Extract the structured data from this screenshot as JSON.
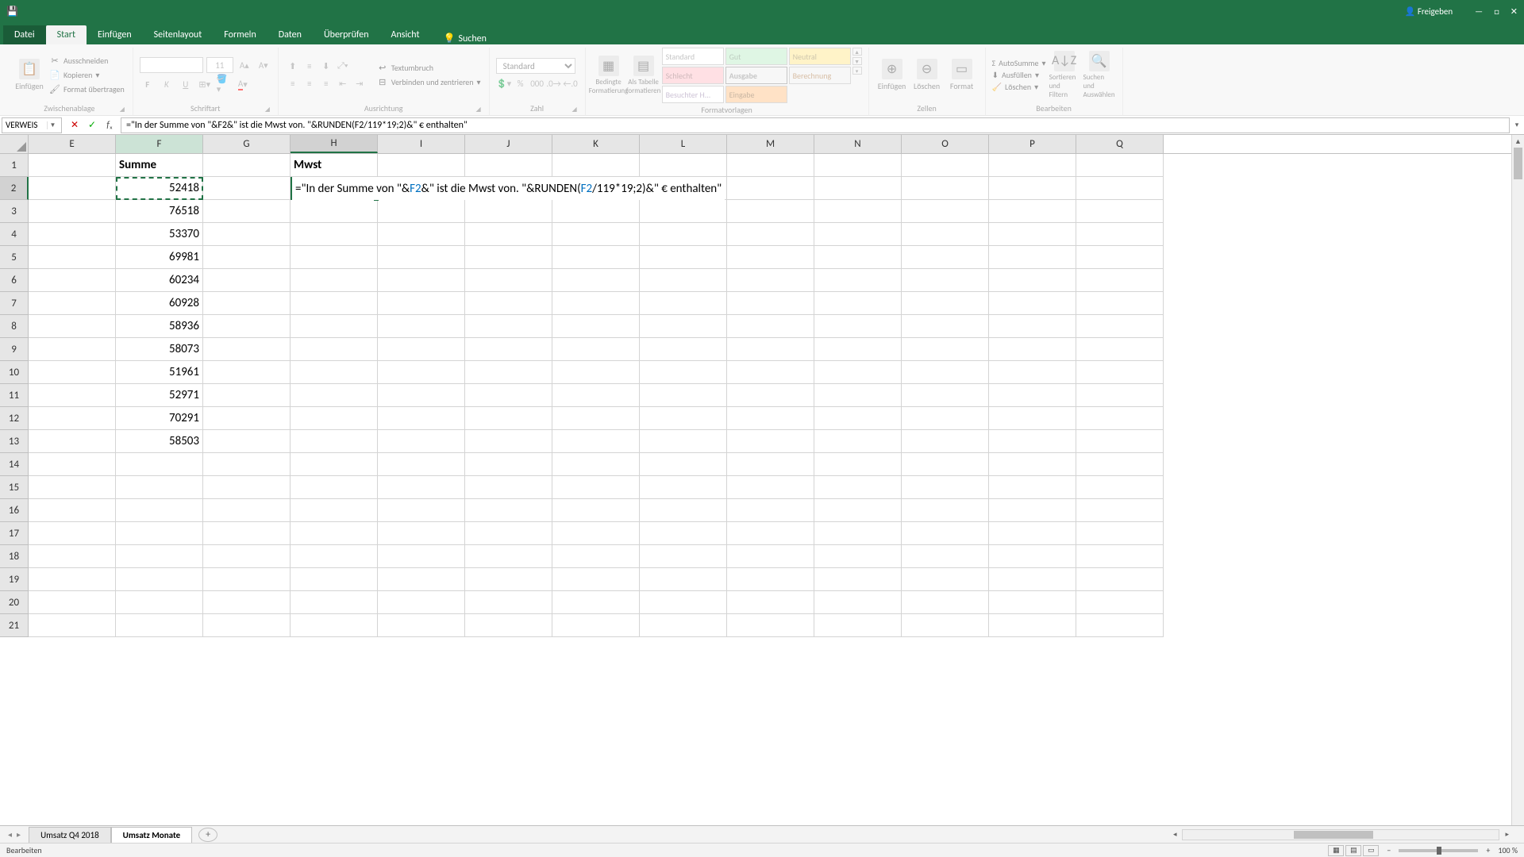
{
  "title_bar": {
    "share": "Freigeben"
  },
  "tabs": {
    "datei": "Datei",
    "start": "Start",
    "einfuegen": "Einfügen",
    "seitenlayout": "Seitenlayout",
    "formeln": "Formeln",
    "daten": "Daten",
    "ueberpruefen": "Überprüfen",
    "ansicht": "Ansicht",
    "tellme": "Suchen"
  },
  "ribbon": {
    "clipboard": {
      "paste": "Einfügen",
      "cut": "Ausschneiden",
      "copy": "Kopieren",
      "format_painter": "Format übertragen",
      "label": "Zwischenablage"
    },
    "font": {
      "name": "",
      "size": "11",
      "label": "Schriftart"
    },
    "alignment": {
      "wrap": "Textumbruch",
      "merge": "Verbinden und zentrieren",
      "label": "Ausrichtung"
    },
    "number": {
      "format": "Standard",
      "label": "Zahl"
    },
    "styles": {
      "cond": "Bedingte Formatierung",
      "table": "Als Tabelle formatieren",
      "items": [
        "Standard",
        "Gut",
        "Neutral",
        "Schlecht",
        "Ausgabe",
        "Berechnung",
        "Besuchter H...",
        "Eingabe"
      ],
      "label": "Formatvorlagen"
    },
    "cells": {
      "insert": "Einfügen",
      "delete": "Löschen",
      "format": "Format",
      "label": "Zellen"
    },
    "editing": {
      "sum": "AutoSumme",
      "fill": "Ausfüllen",
      "clear": "Löschen",
      "sort": "Sortieren und Filtern",
      "find": "Suchen und Auswählen",
      "label": "Bearbeiten"
    }
  },
  "formula_bar": {
    "name_box": "VERWEIS",
    "formula": "=\"In der Summe von \"&F2&\" ist die Mwst von. \"&RUNDEN(F2/119*19;2)&\" € enthalten\""
  },
  "columns": {
    "E": 110,
    "F": 110,
    "G": 110,
    "H": 110,
    "I": 110,
    "J": 110,
    "K": 110,
    "L": 110,
    "M": 110,
    "N": 110,
    "O": 110,
    "P": 110,
    "Q": 110
  },
  "headers": {
    "F1": "Summe",
    "H1": "Mwst"
  },
  "data_F": [
    "52418",
    "76518",
    "53370",
    "69981",
    "60234",
    "60928",
    "58936",
    "58073",
    "51961",
    "52971",
    "70291",
    "58503"
  ],
  "h2_formula_parts": {
    "p1": "=\"In der Summe von \"&",
    "ref1": "F2",
    "p2": "&\" ist die Mwst von. \"&RUNDEN(",
    "ref2": "F2",
    "p3": "/119*19;2)&\" € enthalten\"",
    "cursor_after": "&"
  },
  "sheet_tabs": {
    "t1": "Umsatz Q4 2018",
    "t2": "Umsatz Monate"
  },
  "status": {
    "mode": "Bearbeiten",
    "zoom": "100 %"
  },
  "chart_data": {
    "type": "table",
    "title": "Summe",
    "columns": [
      "Summe"
    ],
    "rows": [
      [
        52418
      ],
      [
        76518
      ],
      [
        53370
      ],
      [
        69981
      ],
      [
        60234
      ],
      [
        60928
      ],
      [
        58936
      ],
      [
        58073
      ],
      [
        51961
      ],
      [
        52971
      ],
      [
        70291
      ],
      [
        58503
      ]
    ]
  }
}
